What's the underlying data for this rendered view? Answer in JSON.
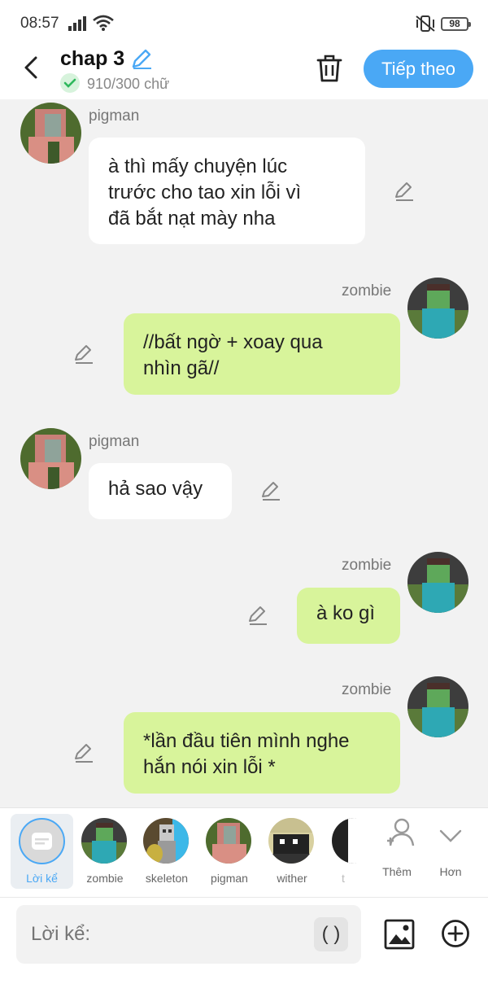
{
  "status": {
    "time": "08:57",
    "battery": "98"
  },
  "header": {
    "title": "chap 3",
    "word_count": "910/300 chữ",
    "next_label": "Tiếp theo"
  },
  "messages": [
    {
      "sender": "pigman",
      "side": "left",
      "text": "à thì mấy chuyện lúc\ntrước cho tao xin lỗi vì\nđã bắt nạt mày nha"
    },
    {
      "sender": "zombie",
      "side": "right",
      "text": "//bất ngờ + xoay qua\nnhìn gã//"
    },
    {
      "sender": "pigman",
      "side": "left",
      "text": "hả sao vậy"
    },
    {
      "sender": "zombie",
      "side": "right",
      "text": "à ko gì"
    },
    {
      "sender": "zombie",
      "side": "right",
      "text": "*lần đầu tiên mình nghe\nhắn nói xin lỗi *"
    }
  ],
  "characters": {
    "narrator": "Lời kể",
    "items": [
      "zombie",
      "skeleton",
      "pigman",
      "wither",
      "t"
    ],
    "more_add": "Thêm",
    "more": "Hơn"
  },
  "input": {
    "placeholder": "Lời kể:",
    "paren": "( )"
  },
  "colors": {
    "accent": "#4aa8f5",
    "right_bubble": "#d8f49b",
    "left_bubble": "#ffffff"
  }
}
